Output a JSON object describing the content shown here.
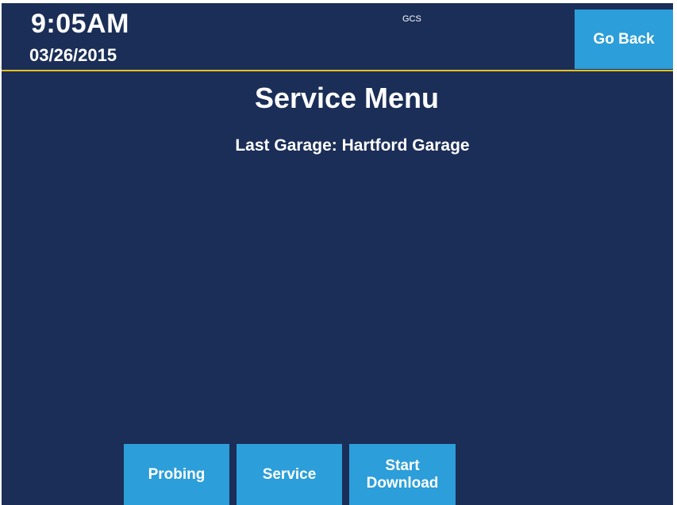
{
  "header": {
    "time": "9:05AM",
    "date": "03/26/2015",
    "label": "GCS",
    "go_back_label": "Go Back"
  },
  "main": {
    "title": "Service Menu",
    "last_garage": "Last Garage: Hartford Garage"
  },
  "buttons": {
    "probing": "Probing",
    "service": "Service",
    "start_download": "Start\nDownload"
  },
  "colors": {
    "background": "#1b2e58",
    "button": "#2c9ed9",
    "divider": "#e8c21a",
    "text": "#ffffff"
  }
}
